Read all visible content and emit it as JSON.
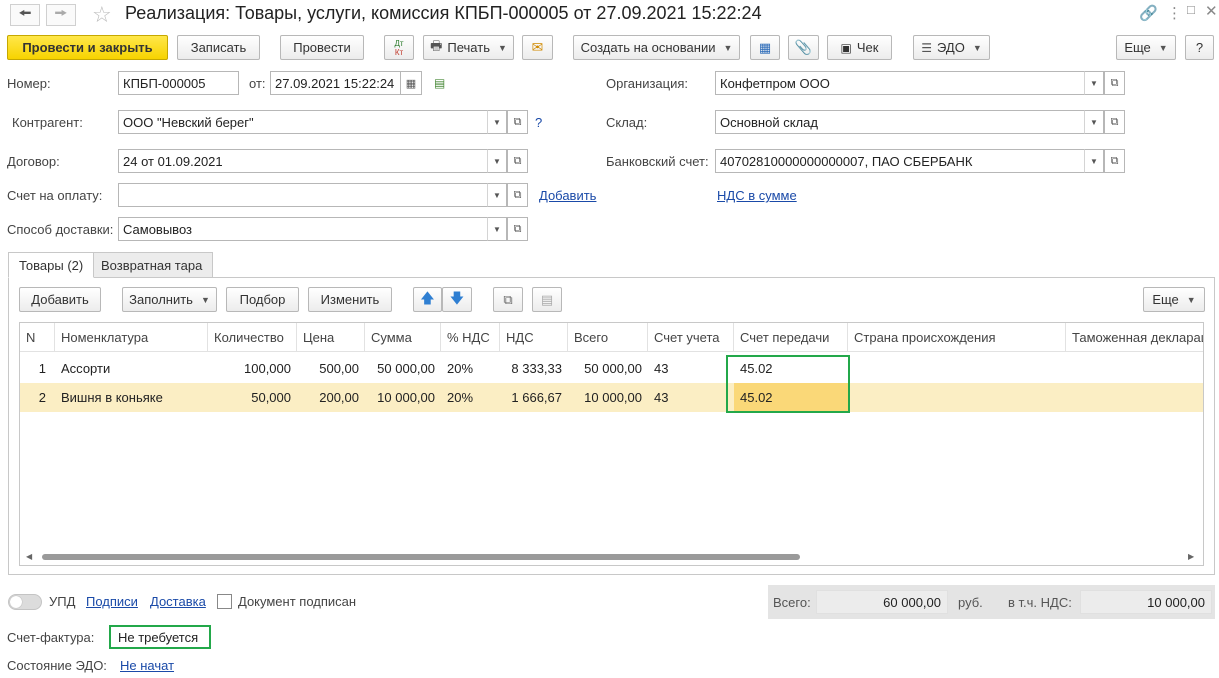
{
  "window": {
    "title": "Реализация: Товары, услуги, комиссия КПБП-000005 от 27.09.2021 15:22:24"
  },
  "toolbar": {
    "post_close": "Провести и закрыть",
    "save": "Записать",
    "post": "Провести",
    "dtkt_top": "Дт",
    "dtkt_bottom": "Кт",
    "print": "Печать",
    "create_based": "Создать на основании",
    "receipt": "Чек",
    "edo": "ЭДО",
    "more": "Еще",
    "help": "?"
  },
  "form": {
    "number_label": "Номер:",
    "number_value": "КПБП-000005",
    "date_label": "от:",
    "date_value": "27.09.2021 15:22:24",
    "org_label": "Организация:",
    "org_value": "Конфетпром ООО",
    "counterparty_label": "Контрагент:",
    "counterparty_value": "ООО \"Невский берег\"",
    "question": "?",
    "warehouse_label": "Склад:",
    "warehouse_value": "Основной склад",
    "contract_label": "Договор:",
    "contract_value": "24 от 01.09.2021",
    "bank_label": "Банковский счет:",
    "bank_value": "40702810000000000007, ПАО СБЕРБАНК",
    "invoice_label": "Счет на оплату:",
    "invoice_value": "",
    "add_link": "Добавить",
    "vat_link": "НДС в сумме",
    "delivery_label": "Способ доставки:",
    "delivery_value": "Самовывоз"
  },
  "tabs": [
    {
      "label": "Товары (2)",
      "active": true
    },
    {
      "label": "Возвратная тара",
      "active": false
    }
  ],
  "table_toolbar": {
    "add": "Добавить",
    "fill": "Заполнить",
    "select": "Подбор",
    "edit": "Изменить",
    "more": "Еще"
  },
  "table": {
    "columns": [
      "N",
      "Номенклатура",
      "Количество",
      "Цена",
      "Сумма",
      "% НДС",
      "НДС",
      "Всего",
      "Счет учета",
      "Счет передачи",
      "Страна происхождения",
      "Таможенная декларация"
    ],
    "rows": [
      [
        "1",
        "Ассорти",
        "100,000",
        "500,00",
        "50 000,00",
        "20%",
        "8 333,33",
        "50 000,00",
        "43",
        "45.02",
        "",
        ""
      ],
      [
        "2",
        "Вишня в коньяке",
        "50,000",
        "200,00",
        "10 000,00",
        "20%",
        "1 666,67",
        "10 000,00",
        "43",
        "45.02",
        "",
        ""
      ]
    ]
  },
  "footer": {
    "upd": "УПД",
    "signatures": "Подписи",
    "delivery": "Доставка",
    "signed": "Документ подписан",
    "total_label": "Всего:",
    "total_value": "60 000,00",
    "currency": "руб.",
    "vat_label": "в т.ч. НДС:",
    "vat_value": "10 000,00",
    "sf_label": "Счет-фактура:",
    "sf_value": "Не требуется",
    "edo_label": "Состояние ЭДО:",
    "edo_value": "Не начат"
  },
  "colors": {
    "primary_button": "#f7d300",
    "selected_row": "#fbeec4",
    "highlight_border": "#23a84a",
    "link": "#1a4aa8"
  }
}
